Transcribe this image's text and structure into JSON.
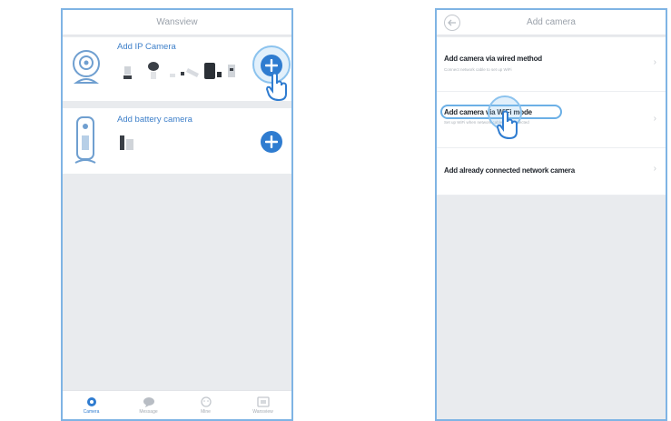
{
  "left_screen": {
    "title": "Wansview",
    "cards": {
      "ip_camera": {
        "label": "Add IP Camera"
      },
      "battery_camera": {
        "label": "Add battery camera"
      }
    },
    "nav": [
      {
        "label": "Camera",
        "icon": "camera-icon",
        "active": true
      },
      {
        "label": "Message",
        "icon": "message-icon",
        "active": false
      },
      {
        "label": "Mine",
        "icon": "mine-icon",
        "active": false
      },
      {
        "label": "Wansview",
        "icon": "wansview-icon",
        "active": false
      }
    ]
  },
  "right_screen": {
    "title": "Add camera",
    "items": [
      {
        "title": "Add camera via wired method",
        "subtitle": "Connect network cable to set up WiFi"
      },
      {
        "title": "Add camera via WiFi mode",
        "subtitle": "Set up WiFi when network cable not connected"
      },
      {
        "title": "Add already connected network camera",
        "subtitle": ""
      }
    ]
  },
  "colors": {
    "accent": "#2f7cd0",
    "frame": "#7fb4e4",
    "background": "#e9ebee"
  }
}
